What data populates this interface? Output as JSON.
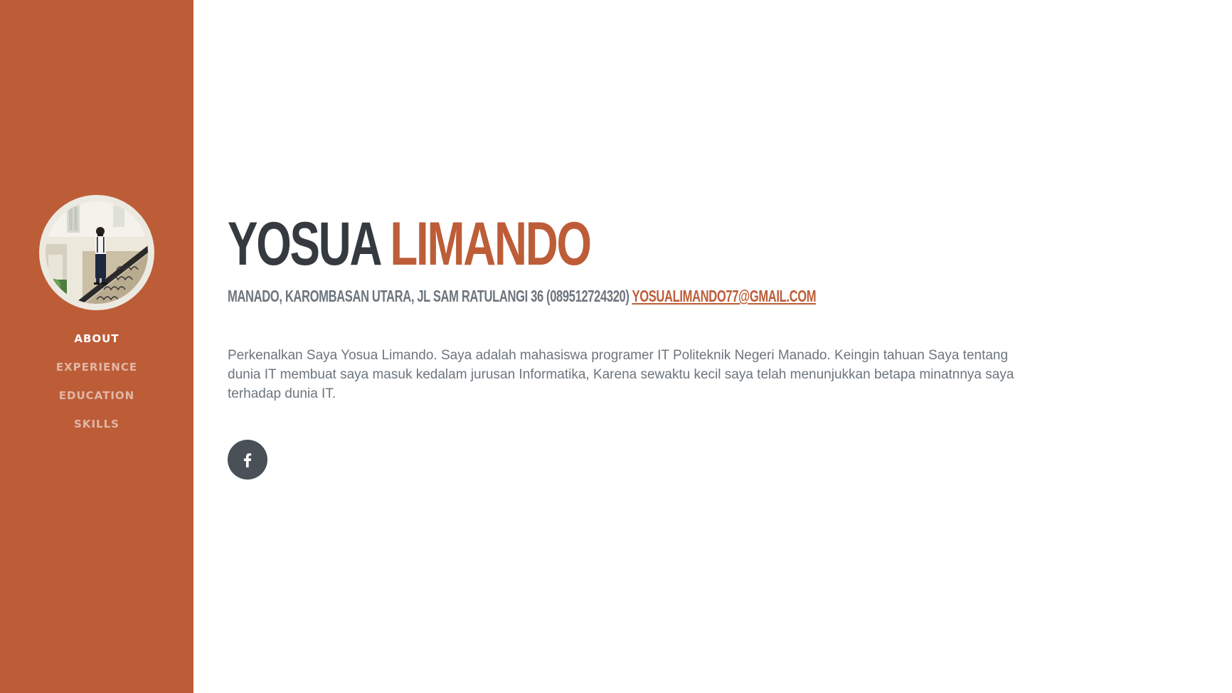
{
  "sidebar": {
    "avatar_alt": "profile photo",
    "nav": [
      {
        "label": "About",
        "active": true
      },
      {
        "label": "Experience",
        "active": false
      },
      {
        "label": "Education",
        "active": false
      },
      {
        "label": "Skills",
        "active": false
      }
    ]
  },
  "about": {
    "first_name": "YOSUA",
    "last_name": "LIMANDO",
    "address": "MANADO, KAROMBASAN UTARA, JL SAM RATULANGI 36 (089512724320)",
    "email": "YOSUALIMANDO77@GMAIL.COM",
    "lead": "Perkenalkan Saya Yosua Limando. Saya adalah mahasiswa programer IT Politeknik Negeri Manado. Keingin tahuan Saya tentang dunia IT membuat saya masuk kedalam jurusan Informatika, Karena sewaktu kecil saya telah menunjukkan betapa minatnnya saya terhadap dunia IT.",
    "social": [
      {
        "icon": "facebook-icon"
      }
    ]
  },
  "colors": {
    "primary": "#bd5d38",
    "heading": "#343a40",
    "muted": "#6c757d",
    "social_bg": "#495057"
  }
}
